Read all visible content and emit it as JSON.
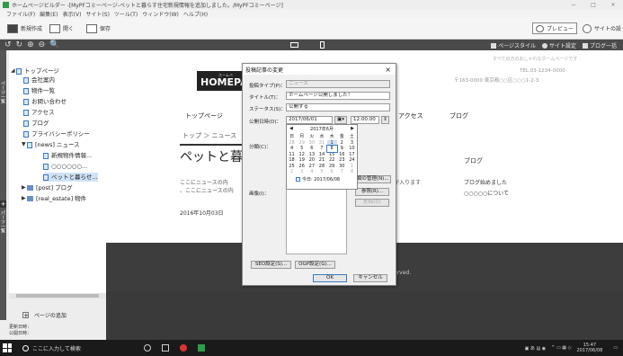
{
  "window": {
    "title": "ホームページビルダー -[MyPFコミーページ-ペットと暮らす住宅新規情報を追加しました。/MyPFコミーページ]",
    "controls": [
      "－",
      "□",
      "×"
    ]
  },
  "menu": [
    "ファイル(F)",
    "編集(E)",
    "表示(V)",
    "サイト(S)",
    "ツール(T)",
    "ウィンドウ(W)",
    "ヘルプ(H)"
  ],
  "toolbar": {
    "new_label": "新規作成",
    "open_label": "開く",
    "save_label": "保存",
    "preview_label": "プレビュー",
    "site_settings_label": "サイトの設"
  },
  "view_bar": {
    "page_style": "ページスタイル",
    "site_settings": "サイト設定",
    "blog_info": "ブログ一括"
  },
  "nav_icons": [
    "↺",
    "↻",
    "⊕",
    "⊖",
    "🔍"
  ],
  "side_tab": {
    "top": "ページ一覧",
    "bottom": "パーツ一覧"
  },
  "tree": {
    "items": [
      {
        "label": "トップページ"
      },
      {
        "label": "会社案内"
      },
      {
        "label": "物件一覧"
      },
      {
        "label": "お問い合わせ"
      },
      {
        "label": "アクセス"
      },
      {
        "label": "ブログ"
      },
      {
        "label": "プライバシーポリシー"
      },
      {
        "label": "[news] ニュース"
      },
      {
        "label": "新規物件情報..."
      },
      {
        "label": "○○○○○○..."
      },
      {
        "label": "ペットと暮らせ..."
      },
      {
        "label": "[post] ブログ"
      },
      {
        "label": "[real_estate] 物件"
      }
    ]
  },
  "add_page": "ページの追加",
  "update_info": {
    "updated": "更新日時：",
    "published": "公開日時："
  },
  "site": {
    "logo": "HOMEPAG",
    "tagline": "ホームペ",
    "header_right_1": "すべての方のおしゃれなホームページです",
    "tel": "TEL.03-1234-0000",
    "address": "〒163-0000 東京都○○区○○○1-2-3",
    "nav_top": "トップページ",
    "nav_access": "アクセス",
    "nav_blog": "ブログ",
    "breadcrumb": "トップ ＞ ニュース",
    "article_title": "ペットと暮",
    "article_text_1": "ここにニュースの内",
    "article_text_2": "、ここにニュースの内",
    "article_date": "2016年10月03日",
    "side_text": "の内容が入ります",
    "blog_heading": "ブログ",
    "blog_item_1": "ブログ始めました",
    "blog_item_2": "○○○○○について",
    "footer": "erved."
  },
  "dialog": {
    "title": "投稿記事の変更",
    "close": "×",
    "post_type_label": "投稿タイプ(P)：",
    "post_type_value": "ニュース",
    "title_label": "タイトル(T)：",
    "title_value": "ホームページ公開しました！",
    "status_label": "ステータス(S)：",
    "status_value": "公開する",
    "date_label": "公開日時(D)：",
    "date_value": "2017/06/01",
    "time_value": "12:00:00",
    "category_label": "分類(C)：",
    "category_manage": "分類の管理(N)...",
    "image_label": "画像(I)：",
    "ref_button": "参照(R)...",
    "delete_button": "削除(D)",
    "seo_button": "SEO設定(S)...",
    "ogp_button": "OGP設定(G)...",
    "ok_button": "OK",
    "cancel_button": "キャンセル"
  },
  "calendar": {
    "month": "2017年6月",
    "prev": "◀",
    "next": "▶",
    "weekdays": [
      "日",
      "月",
      "火",
      "水",
      "木",
      "金",
      "土"
    ],
    "weeks": [
      [
        "28",
        "29",
        "30",
        "31",
        "1",
        "2",
        "3"
      ],
      [
        "4",
        "5",
        "6",
        "7",
        "8",
        "9",
        "10"
      ],
      [
        "11",
        "12",
        "13",
        "14",
        "15",
        "16",
        "17"
      ],
      [
        "18",
        "19",
        "20",
        "21",
        "22",
        "23",
        "24"
      ],
      [
        "25",
        "26",
        "27",
        "28",
        "29",
        "30",
        "1"
      ],
      [
        "2",
        "3",
        "4",
        "5",
        "6",
        "7",
        "8"
      ]
    ],
    "today": "今日: 2017/06/08"
  },
  "taskbar": {
    "search": "ここに入力して検索",
    "time": "15:47",
    "date": "2017/06/08"
  }
}
